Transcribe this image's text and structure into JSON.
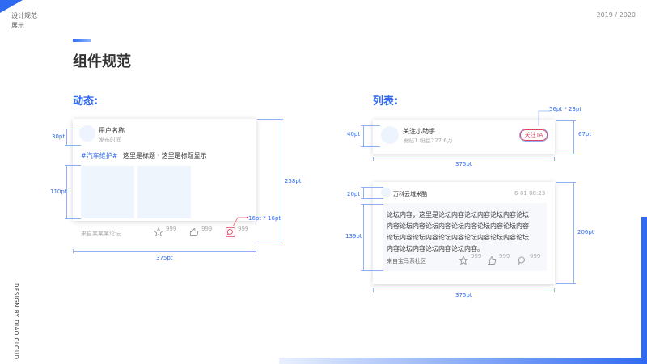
{
  "header": {
    "line1": "设计规范",
    "line2": "展示",
    "year": "2019 / 2020"
  },
  "page_title": "组件规范",
  "side_text": "DESIGN BY DIAO CLOUD.",
  "sections": {
    "dynamic": "动态:",
    "list": "列表:"
  },
  "dynamic_card": {
    "username": "用户名称",
    "publish_time": "发布时间",
    "tag": "#汽车维护#",
    "title": "这里是标题 · 这里是标题显示",
    "source": "来自某某某论坛",
    "star_count": "999",
    "like_count": "999",
    "comment_count": "999"
  },
  "dynamic_dims": {
    "header_h": "30pt",
    "image_h": "110pt",
    "total_h": "258pt",
    "width": "375pt",
    "icon_size": "16pt * 16pt"
  },
  "list_card1": {
    "name": "关注小助手",
    "meta": "发贴1  粉丝227.6万",
    "follow_button": "关注TA"
  },
  "list_dims1": {
    "button_size": "56pt * 23pt",
    "avatar_h": "40pt",
    "total_h": "67pt",
    "width": "375pt"
  },
  "list_card2": {
    "user": "万科云城米酷",
    "date": "6-01 08:23",
    "content": [
      "论坛内容，这里是论坛内容论坛内容论坛内容论坛",
      "内容论坛内容论坛内容论坛内容论坛内容论坛内容",
      "论坛内容论坛内容论坛内容论坛内容论坛内容论坛",
      "内容论坛内容论坛内容论坛内容。"
    ],
    "source": "来自宝马系社区",
    "star_count": "999",
    "like_count": "999",
    "comment_count": "999"
  },
  "list_dims2": {
    "header_h": "20pt",
    "content_h": "139pt",
    "total_h": "206pt",
    "width": "375pt"
  },
  "colors": {
    "accent": "#2f6bf2",
    "follow_border": "#e0405f"
  }
}
